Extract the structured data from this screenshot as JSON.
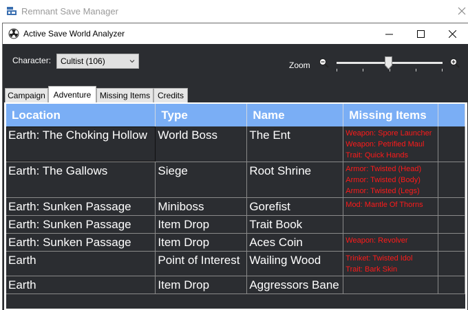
{
  "main_window": {
    "title": "Remnant Save Manager"
  },
  "dialog": {
    "title": "Active Save World Analyzer",
    "character_label": "Character:",
    "character_value": "Cultist (106)",
    "zoom_label": "Zoom",
    "zoom_level": 0.5
  },
  "tabs": [
    {
      "label": "Campaign"
    },
    {
      "label": "Adventure"
    },
    {
      "label": "Missing Items"
    },
    {
      "label": "Credits"
    }
  ],
  "active_tab": "Adventure",
  "table": {
    "headers": [
      "Location",
      "Type",
      "Name",
      "Missing Items"
    ],
    "rows": [
      {
        "location": "Earth: The Choking Hollow",
        "type": "World Boss",
        "name": "The Ent",
        "missing": [
          "Weapon: Spore Launcher",
          "Weapon: Petrified Maul",
          "Trait: Quick Hands"
        ]
      },
      {
        "location": "Earth: The Gallows",
        "type": "Siege",
        "name": "Root Shrine",
        "missing": [
          "Armor: Twisted (Head)",
          "Armor: Twisted (Body)",
          "Armor: Twisted (Legs)"
        ]
      },
      {
        "location": "Earth: Sunken Passage",
        "type": "Miniboss",
        "name": "Gorefist",
        "missing": [
          "Mod: Mantle Of Thorns"
        ]
      },
      {
        "location": "Earth: Sunken Passage",
        "type": "Item Drop",
        "name": "Trait Book",
        "missing": []
      },
      {
        "location": "Earth: Sunken Passage",
        "type": "Item Drop",
        "name": "Aces Coin",
        "missing": [
          "Weapon: Revolver"
        ]
      },
      {
        "location": "Earth",
        "type": "Point of Interest",
        "name": "Wailing Wood",
        "missing": [
          "Trinket: Twisted Idol",
          "Trait: Bark Skin"
        ]
      },
      {
        "location": "Earth",
        "type": "Item Drop",
        "name": "Aggressors Bane",
        "missing": []
      }
    ]
  },
  "colors": {
    "header_bg": "#7aaef5",
    "grid_bg": "#2b2d31",
    "missing_text": "#ff1a1a"
  }
}
